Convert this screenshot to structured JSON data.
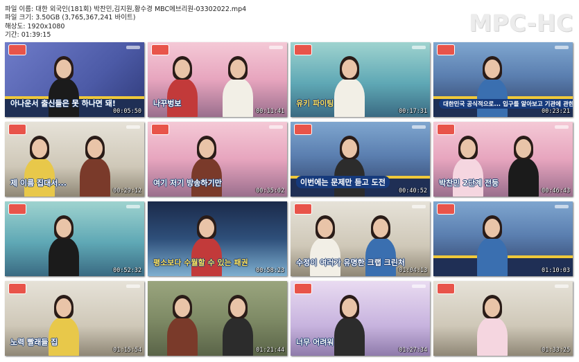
{
  "file_info": {
    "name_line": "파일 이름: 대한 외국인(181회) 박찬민,김지원,황수경 MBC에브리원-03302022.mp4",
    "size_line": "파일 크기: 3.50GB (3,765,367,241 바이트)",
    "resolution_line": "해상도: 1920x1080",
    "duration_line": "기간: 01:39:15"
  },
  "logo_text": "MPC-HC",
  "thumbnails": [
    {
      "time": "00:05:50",
      "caption": "아나운서 출신들은 못 하나면 돼!",
      "style": "purple"
    },
    {
      "time": "00:11:41",
      "caption": "나꾸벙보",
      "style": "pink"
    },
    {
      "time": "00:17:31",
      "caption": "유키          파이팅",
      "style": "teal"
    },
    {
      "time": "00:23:21",
      "caption": "대한민국 공식적으로... 입구를 알아보고 기관에 관한 문제",
      "style": "studio"
    },
    {
      "time": "00:29:12",
      "caption": "제 이름 집대서...",
      "style": "wall"
    },
    {
      "time": "00:35:02",
      "caption": "여기 저기 방송하기만",
      "style": "pink"
    },
    {
      "time": "00:40:52",
      "caption": "이번에는 문제만 듣고 도전",
      "style": "studio"
    },
    {
      "time": "00:46:43",
      "caption": "박찬민 2단계 전등",
      "style": "pink"
    },
    {
      "time": "00:52:32",
      "caption": "",
      "style": "teal"
    },
    {
      "time": "00:58:23",
      "caption": "평소보다 수월할 수 있는 패권",
      "style": "stage"
    },
    {
      "time": "01:04:13",
      "caption": "수정이 여러가 유명한 크랩 크린처",
      "style": "wall"
    },
    {
      "time": "01:10:03",
      "caption": "",
      "style": "studio"
    },
    {
      "time": "01:15:54",
      "caption": "노력 빨래들 집",
      "style": "wall"
    },
    {
      "time": "01:21:44",
      "caption": "",
      "style": "hill"
    },
    {
      "time": "01:27:34",
      "caption": "너무 어려워",
      "style": "lilac"
    },
    {
      "time": "01:33:25",
      "caption": "",
      "style": "wall"
    }
  ]
}
